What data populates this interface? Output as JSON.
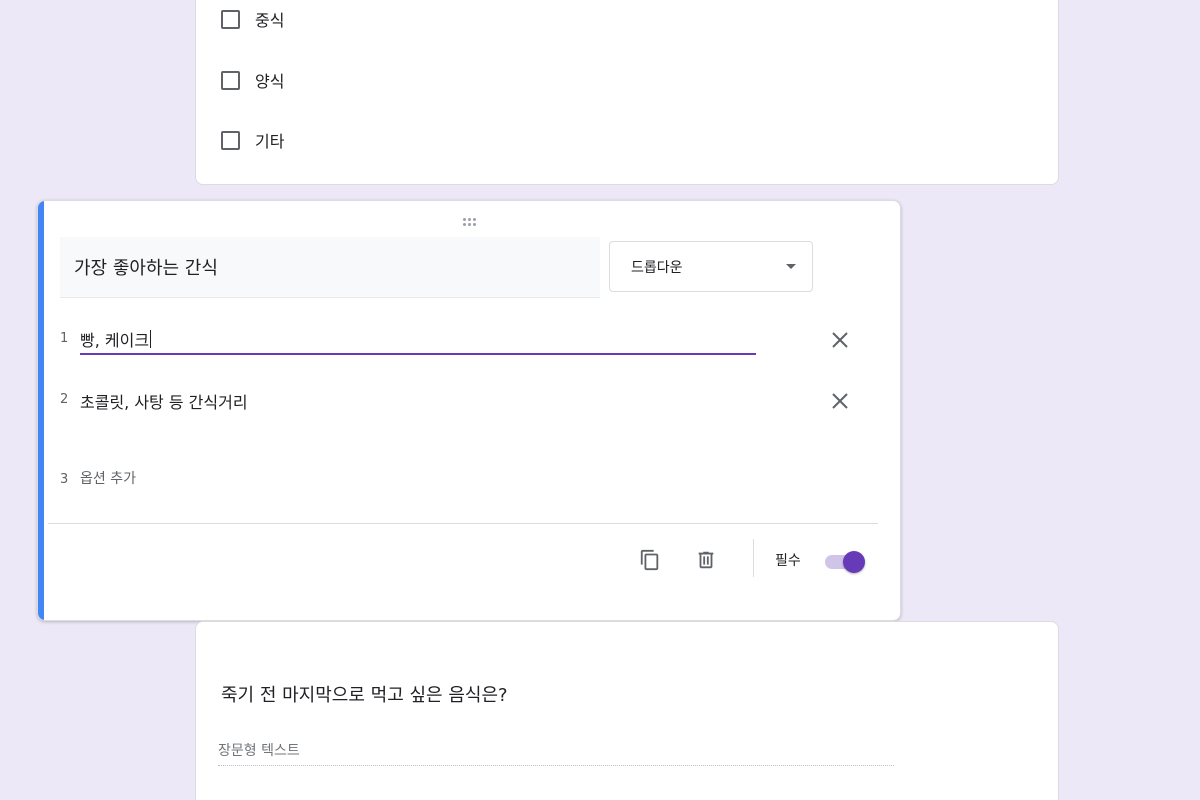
{
  "theme": {
    "background": "#ede8f7",
    "accent": "#673ab7",
    "active_bar": "#4285f4"
  },
  "prev_question": {
    "options": [
      {
        "label": "중식"
      },
      {
        "label": "양식"
      },
      {
        "label": "기타"
      }
    ]
  },
  "active_question": {
    "title": "가장 좋아하는 간식",
    "type": "드롭다운",
    "options": [
      {
        "number": "1",
        "value": "빵, 케이크",
        "focused": true
      },
      {
        "number": "2",
        "value": "초콜릿, 사탕 등 간식거리",
        "focused": false
      }
    ],
    "add_option": {
      "number": "3",
      "label": "옵션 추가"
    },
    "footer": {
      "duplicate_icon": "copy-icon",
      "delete_icon": "trash-icon",
      "required_label": "필수",
      "required": true
    }
  },
  "next_question": {
    "title": "죽기 전 마지막으로 먹고 싶은 음식은?",
    "answer_placeholder": "장문형 텍스트"
  }
}
